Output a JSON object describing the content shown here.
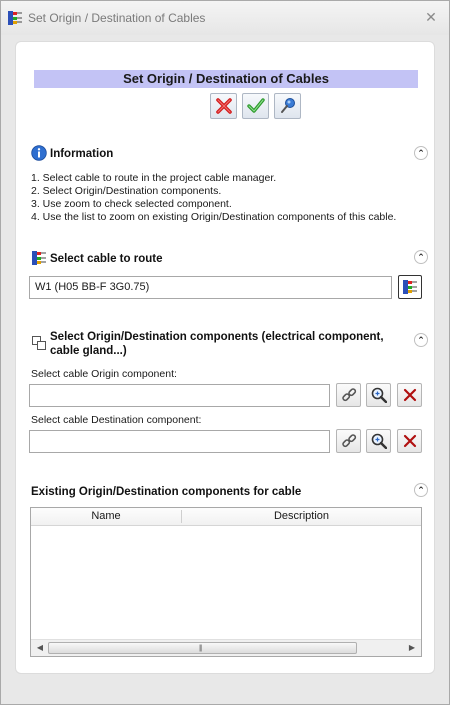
{
  "window": {
    "title": "Set Origin / Destination of Cables",
    "close_glyph": "✕"
  },
  "header": {
    "title": "Set Origin / Destination of Cables"
  },
  "toolbar": {
    "cancel_icon": "red-x-icon",
    "ok_icon": "green-check-icon",
    "pin_icon": "pushpin-icon"
  },
  "information": {
    "title": "Information",
    "lines": [
      "1. Select cable to route in the project cable manager.",
      "2. Select Origin/Destination components.",
      "3. Use zoom to check selected component.",
      "4. Use the list to zoom on existing Origin/Destination components of this cable."
    ]
  },
  "select_cable": {
    "title": "Select cable to route",
    "value": "W1 (H05 BB-F 3G0.75)"
  },
  "components": {
    "title_line1": "Select Origin/Destination components (electrical component,",
    "title_line2": "cable gland...)",
    "origin_label": "Select cable Origin component:",
    "origin_value": "",
    "destination_label": "Select cable Destination component:",
    "destination_value": ""
  },
  "existing": {
    "title": "Existing Origin/Destination components for cable",
    "columns": [
      "Name",
      "Description"
    ],
    "rows": []
  },
  "icons": {
    "collapse": "⌃"
  },
  "colors": {
    "header_bg": "#c3c3f5",
    "delete_red": "#b01010",
    "ok_green": "#2e9a2e"
  }
}
